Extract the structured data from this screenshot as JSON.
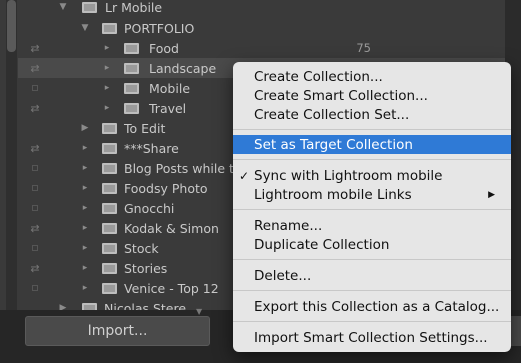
{
  "tree": {
    "root": "Lr Mobile",
    "portfolio": "PORTFOLIO",
    "items": [
      {
        "label": "Food",
        "count": "75"
      },
      {
        "label": "Landscape",
        "count": ""
      },
      {
        "label": "Mobile",
        "count": ""
      },
      {
        "label": "Travel",
        "count": ""
      }
    ],
    "to_edit": "To Edit",
    "collections": [
      "***Share",
      "Blog Posts while tra",
      "Foodsy Photo",
      "Gnocchi",
      "Kodak & Simon",
      "Stock",
      "Stories",
      "Venice - Top 12",
      "Nicolas Stere"
    ]
  },
  "bottom": {
    "import_label": "Import..."
  },
  "menu": {
    "items": [
      "Create Collection...",
      "Create Smart Collection...",
      "Create Collection Set...",
      "Set as Target Collection",
      "Sync with Lightroom mobile",
      "Lightroom mobile Links",
      "Rename...",
      "Duplicate Collection",
      "Delete...",
      "Export this Collection as a Catalog...",
      "Import Smart Collection Settings..."
    ],
    "checkmark": "✓",
    "submenu_arrow": "▶"
  },
  "colors": {
    "panel_bg": "#3a3a3a",
    "menu_bg": "#e6e6e6",
    "highlight": "#2f7ad6"
  }
}
